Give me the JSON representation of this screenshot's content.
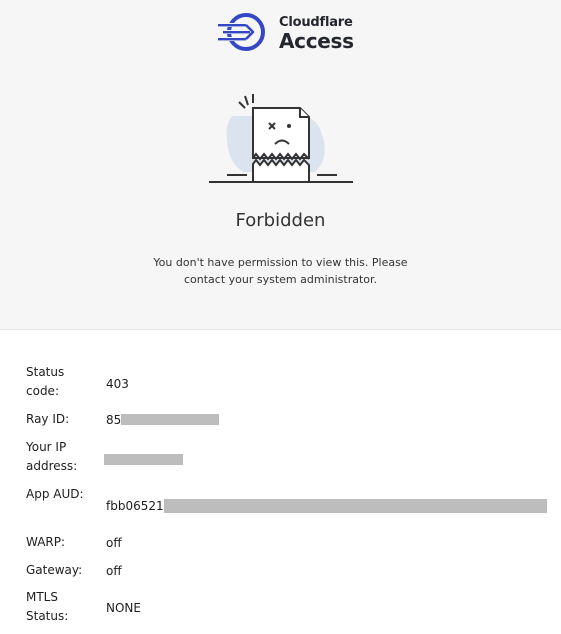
{
  "brand": {
    "name_small": "Cloudflare",
    "name_big": "Access",
    "accent_color": "#3448c5"
  },
  "error": {
    "title": "Forbidden",
    "message": "You don't have permission to view this. Please contact your system administrator."
  },
  "details": {
    "status_code": {
      "label": "Status code:",
      "value": "403"
    },
    "ray_id": {
      "label": "Ray ID:",
      "value": "85"
    },
    "ip_address": {
      "label": "Your IP address:",
      "value": ""
    },
    "app_aud": {
      "label": "App AUD:",
      "value": "fbb06521"
    },
    "warp": {
      "label": "WARP:",
      "value": "off"
    },
    "gateway": {
      "label": "Gateway:",
      "value": "off"
    },
    "mtls": {
      "label": "MTLS Status:",
      "value": "NONE"
    }
  }
}
